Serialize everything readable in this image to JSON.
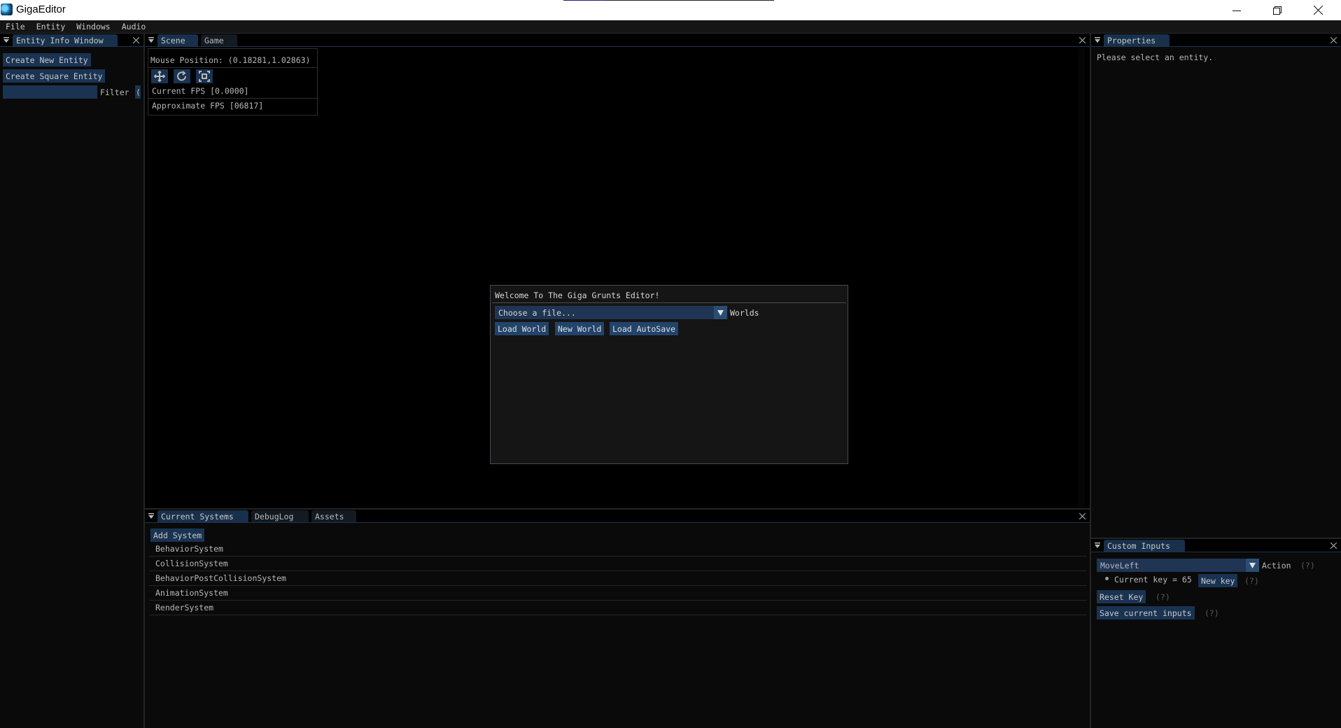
{
  "window": {
    "title": "GigaEditor",
    "progress_fraction": 0.2,
    "icons": {
      "app": "app-icon",
      "minimize": "minimize-icon",
      "maximize": "restore-icon",
      "close": "close-icon"
    }
  },
  "menubar": {
    "items": [
      "File",
      "Entity",
      "Windows",
      "Audio"
    ]
  },
  "entity_info": {
    "tab": "Entity Info Window",
    "create_new_entity": "Create New Entity",
    "create_square_entity": "Create Square Entity",
    "filter_label": "Filter",
    "filter_value": "",
    "filter_clear_glyph": "("
  },
  "scene": {
    "tabs": [
      "Scene",
      "Game"
    ],
    "active_tab": "Scene",
    "mouse_position": "Mouse Position: (0.18281,1.02863)",
    "tools": [
      "translate-tool",
      "rotate-tool",
      "scale-tool"
    ],
    "current_fps": "Current FPS [0.0000]",
    "approx_fps": "Approximate FPS [06817]"
  },
  "welcome_dialog": {
    "title": "Welcome To The Giga Grunts Editor!",
    "combo_value": "Choose a file...",
    "combo_label": "Worlds",
    "buttons": [
      "Load World",
      "New World",
      "Load AutoSave"
    ]
  },
  "systems_panel": {
    "tabs": [
      "Current Systems",
      "DebugLog",
      "Assets"
    ],
    "active_tab": "Current Systems",
    "add_button": "Add System",
    "systems": [
      "BehaviorSystem",
      "CollisionSystem",
      "BehaviorPostCollisionSystem",
      "AnimationSystem",
      "RenderSystem"
    ]
  },
  "properties": {
    "tab": "Properties",
    "message": "Please select an entity."
  },
  "custom_inputs": {
    "tab": "Custom Inputs",
    "action_value": "MoveLeft",
    "action_label": "Action",
    "help": "(?)",
    "current_key": "Current key = 65",
    "new_key": "New key",
    "reset_key": "Reset Key",
    "save_inputs": "Save current inputs"
  }
}
